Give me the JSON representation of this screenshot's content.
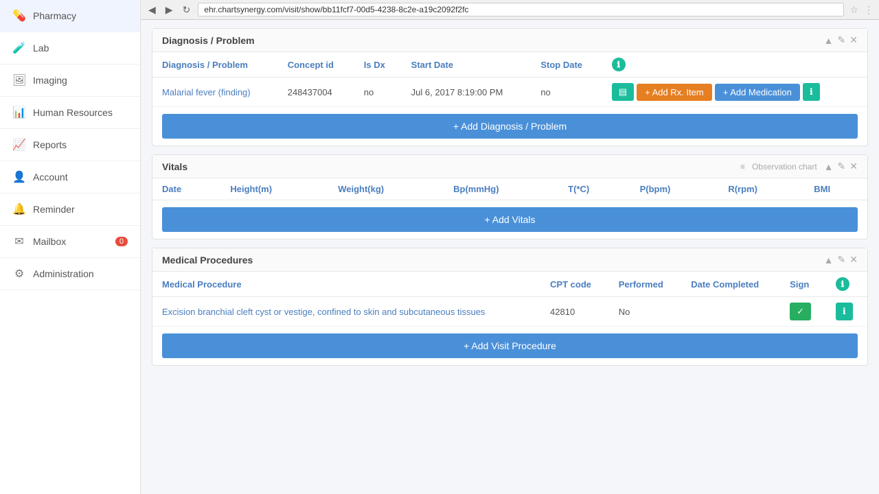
{
  "browser": {
    "url": "ehr.chartsynergy.com/visit/show/bb11fcf7-00d5-4238-8c2e-a19c2092f2fc",
    "back_btn": "◀",
    "forward_btn": "▶",
    "refresh_btn": "↻"
  },
  "sidebar": {
    "items": [
      {
        "id": "pharmacy",
        "label": "Pharmacy",
        "icon": "💊",
        "badge": null
      },
      {
        "id": "lab",
        "label": "Lab",
        "icon": "🧪",
        "badge": null
      },
      {
        "id": "imaging",
        "label": "Imaging",
        "icon": "🖼",
        "badge": null
      },
      {
        "id": "human-resources",
        "label": "Human Resources",
        "icon": "📊",
        "badge": null
      },
      {
        "id": "reports",
        "label": "Reports",
        "icon": "📈",
        "badge": null
      },
      {
        "id": "account",
        "label": "Account",
        "icon": "👤",
        "badge": null
      },
      {
        "id": "reminder",
        "label": "Reminder",
        "icon": "🔔",
        "badge": null
      },
      {
        "id": "mailbox",
        "label": "Mailbox",
        "icon": "✉",
        "badge": "0"
      },
      {
        "id": "administration",
        "label": "Administration",
        "icon": "⚙",
        "badge": null
      }
    ]
  },
  "diagnosis_section": {
    "title": "Diagnosis / Problem",
    "columns": [
      "Diagnosis / Problem",
      "Concept id",
      "Is Dx",
      "Start Date",
      "Stop Date"
    ],
    "rows": [
      {
        "diagnosis": "Malarial fever (finding)",
        "concept_id": "248437004",
        "is_dx": "no",
        "start_date": "Jul 6, 2017 8:19:00 PM",
        "stop_date": "no"
      }
    ],
    "add_btn_label": "+ Add Diagnosis / Problem",
    "add_rx_label": "+ Add Rx. Item",
    "add_med_label": "+ Add Medication"
  },
  "vitals_section": {
    "title": "Vitals",
    "obs_chart_label": "Observation chart",
    "columns": [
      "Date",
      "Height(m)",
      "Weight(kg)",
      "Bp(mmHg)",
      "T(*C)",
      "P(bpm)",
      "R(rpm)",
      "BMI"
    ],
    "rows": [],
    "add_btn_label": "+ Add Vitals"
  },
  "medical_procedures_section": {
    "title": "Medical Procedures",
    "columns": [
      "Medical Procedure",
      "CPT code",
      "Performed",
      "Date Completed",
      "Sign",
      ""
    ],
    "rows": [
      {
        "procedure": "Excision branchial cleft cyst or vestige, confined to skin and subcutaneous tissues",
        "cpt_code": "42810",
        "performed": "No",
        "date_completed": "",
        "sign": "✓"
      }
    ],
    "add_btn_label": "+ Add Visit Procedure"
  }
}
